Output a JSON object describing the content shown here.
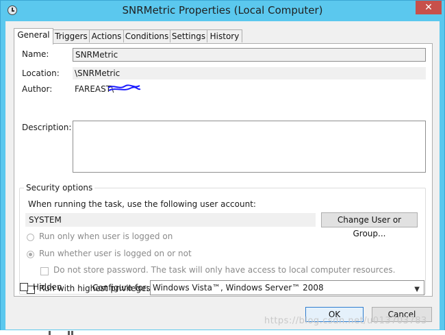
{
  "window": {
    "title": "SNRMetric Properties (Local Computer)",
    "close_glyph": "✕",
    "icon": "clock-icon"
  },
  "tabs": [
    {
      "label": "General",
      "active": true
    },
    {
      "label": "Triggers"
    },
    {
      "label": "Actions"
    },
    {
      "label": "Conditions"
    },
    {
      "label": "Settings"
    },
    {
      "label": "History"
    }
  ],
  "general": {
    "name_label": "Name:",
    "name_value": "SNRMetric",
    "location_label": "Location:",
    "location_value": "\\SNRMetric",
    "author_label": "Author:",
    "author_value": "FAREAST\\",
    "description_label": "Description:",
    "description_value": ""
  },
  "security": {
    "title": "Security options",
    "account_prompt": "When running the task, use the following user account:",
    "account_value": "SYSTEM",
    "change_button": "Change User or Group...",
    "radio_logged_on": "Run only when user is logged on",
    "radio_whether": "Run whether user is logged on or not",
    "no_store_password": "Do not store password.  The task will only have access to local computer resources.",
    "highest_privileges": "Run with highest privileges"
  },
  "bottom": {
    "hidden_label": "Hidden",
    "configure_label": "Configure for:",
    "configure_value": "Windows Vista™, Windows Server™ 2008",
    "ok": "OK",
    "cancel": "Cancel"
  },
  "watermark": "https://blog.csdn.net/u013703783",
  "colors": {
    "titlebar": "#5bc8ee",
    "close": "#c7504b",
    "scribble": "#1a1aff"
  }
}
